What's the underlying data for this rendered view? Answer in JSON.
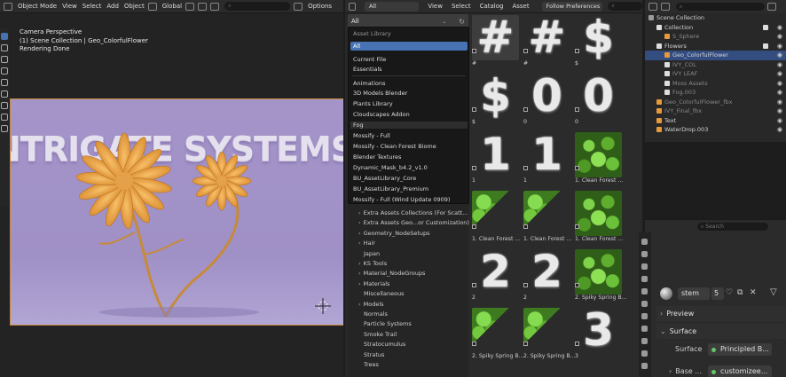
{
  "viewport": {
    "header": {
      "mode": "Object Mode",
      "menu": [
        "View",
        "Select",
        "Add",
        "Object"
      ],
      "orientation": "Global",
      "options": "Options"
    },
    "info": [
      "Camera Perspective",
      "(1) Scene Collection | Geo_ColorfulFlower",
      "Rendering Done"
    ],
    "scene_text": "NTRIGATE SYSTEMS"
  },
  "asset_browser": {
    "header": {
      "filter": "All",
      "menu": [
        "View",
        "Select",
        "Catalog",
        "Asset"
      ],
      "import_method": "Follow Preferences"
    },
    "library_dropdown": {
      "value": "All",
      "menu_header": "Asset Library",
      "selected": "All",
      "items": [
        "Current File",
        "Essentials",
        "Animations",
        "3D Models Blender",
        "Plants Library",
        "Cloudscapes Addon",
        "Fog",
        "Mossify - Full",
        "Mossify - Clean Forest Biome",
        "Blender Textures",
        "Dynamic_Mask_b4.2_v1.0",
        "BU_AssetLibrary_Core",
        "BU_AssetLibrary_Premium",
        "Mossify - Full (Wind Update 0909)"
      ]
    },
    "catalog_tree": [
      {
        "label": "Extra Assets Collections (For Scatt...",
        "arrow": true
      },
      {
        "label": "Extra Assets Geo...or Customization)",
        "arrow": true
      },
      {
        "label": "Geometry_NodeSetups",
        "arrow": true
      },
      {
        "label": "Hair",
        "arrow": true
      },
      {
        "label": "Japan",
        "arrow": false
      },
      {
        "label": "KS Tools",
        "arrow": true
      },
      {
        "label": "Material_NodeGroups",
        "arrow": true
      },
      {
        "label": "Materials",
        "arrow": true
      },
      {
        "label": "Miscellaneous",
        "arrow": false
      },
      {
        "label": "Models",
        "arrow": true
      },
      {
        "label": "Normals",
        "arrow": false
      },
      {
        "label": "Particle Systems",
        "arrow": false
      },
      {
        "label": "Smoke Trail",
        "arrow": false
      },
      {
        "label": "Stratocumulus",
        "arrow": false
      },
      {
        "label": "Stratus",
        "arrow": false
      },
      {
        "label": "Trees",
        "arrow": false
      }
    ],
    "assets": [
      {
        "label": "#",
        "glyph": "#",
        "kind": "glyph"
      },
      {
        "label": "#",
        "glyph": "#",
        "kind": "glyph"
      },
      {
        "label": "$",
        "glyph": "$",
        "kind": "glyph"
      },
      {
        "label": "$",
        "glyph": "$",
        "kind": "glyph"
      },
      {
        "label": "0",
        "glyph": "0",
        "kind": "glyph"
      },
      {
        "label": "0",
        "glyph": "0",
        "kind": "glyph"
      },
      {
        "label": "1",
        "glyph": "1",
        "kind": "glyph"
      },
      {
        "label": "1",
        "glyph": "1",
        "kind": "glyph"
      },
      {
        "label": "1. Clean Forest ...",
        "glyph": "",
        "kind": "leaf"
      },
      {
        "label": "1. Clean Forest ...",
        "glyph": "",
        "kind": "leaf-ang"
      },
      {
        "label": "1. Clean Forest ...",
        "glyph": "",
        "kind": "leaf-ang"
      },
      {
        "label": "1. Clean Forest ...",
        "glyph": "",
        "kind": "leaf"
      },
      {
        "label": "2",
        "glyph": "2",
        "kind": "glyph"
      },
      {
        "label": "2",
        "glyph": "2",
        "kind": "glyph"
      },
      {
        "label": "2. Spiky Spring B...",
        "glyph": "",
        "kind": "leaf"
      },
      {
        "label": "2. Spiky Spring B...",
        "glyph": "",
        "kind": "leaf-ang"
      },
      {
        "label": "2. Spiky Spring B...",
        "glyph": "",
        "kind": "leaf-ang"
      },
      {
        "label": "3",
        "glyph": "3",
        "kind": "glyph"
      }
    ]
  },
  "outliner": {
    "search_placeholder": "",
    "items": [
      {
        "label": "Scene Collection",
        "indent": 0,
        "icon": "#9a9a9a",
        "check": false,
        "eye": false,
        "selected": false,
        "dim": false
      },
      {
        "label": "Collection",
        "indent": 1,
        "icon": "#dddddd",
        "check": true,
        "eye": true,
        "selected": false,
        "dim": false
      },
      {
        "label": "S_Sphere",
        "indent": 2,
        "icon": "#e69a3c",
        "check": false,
        "eye": true,
        "selected": false,
        "dim": true
      },
      {
        "label": "Flowers",
        "indent": 1,
        "icon": "#dddddd",
        "check": true,
        "eye": true,
        "selected": false,
        "dim": false
      },
      {
        "label": "Geo_ColorfulFlower",
        "indent": 2,
        "icon": "#e69a3c",
        "check": false,
        "eye": true,
        "selected": true,
        "dim": false
      },
      {
        "label": "IVY_COL",
        "indent": 2,
        "icon": "#dddddd",
        "check": false,
        "eye": true,
        "selected": false,
        "dim": true
      },
      {
        "label": "IVY LEAF",
        "indent": 2,
        "icon": "#dddddd",
        "check": false,
        "eye": true,
        "selected": false,
        "dim": true
      },
      {
        "label": "Moss Assets",
        "indent": 2,
        "icon": "#dddddd",
        "check": false,
        "eye": true,
        "selected": false,
        "dim": true
      },
      {
        "label": "Fog.003",
        "indent": 2,
        "icon": "#dddddd",
        "check": false,
        "eye": true,
        "selected": false,
        "dim": true
      },
      {
        "label": "Geo_ColorfulFlower_fbx",
        "indent": 1,
        "icon": "#e69a3c",
        "check": false,
        "eye": true,
        "selected": false,
        "dim": true
      },
      {
        "label": "IVY_Final_fbx",
        "indent": 1,
        "icon": "#e69a3c",
        "check": false,
        "eye": true,
        "selected": false,
        "dim": true
      },
      {
        "label": "Text",
        "indent": 1,
        "icon": "#e69a3c",
        "check": false,
        "eye": true,
        "selected": false,
        "dim": false
      },
      {
        "label": "WaterDrop.003",
        "indent": 1,
        "icon": "#e69a3c",
        "check": false,
        "eye": true,
        "selected": false,
        "dim": false
      }
    ]
  },
  "properties": {
    "material_name": "stem",
    "users": "5",
    "panels": {
      "preview": "Preview",
      "surface": "Surface"
    },
    "surface_label": "Surface",
    "surface_value": "Principled B...",
    "base_label": "Base ...",
    "base_value": "customizee..."
  }
}
